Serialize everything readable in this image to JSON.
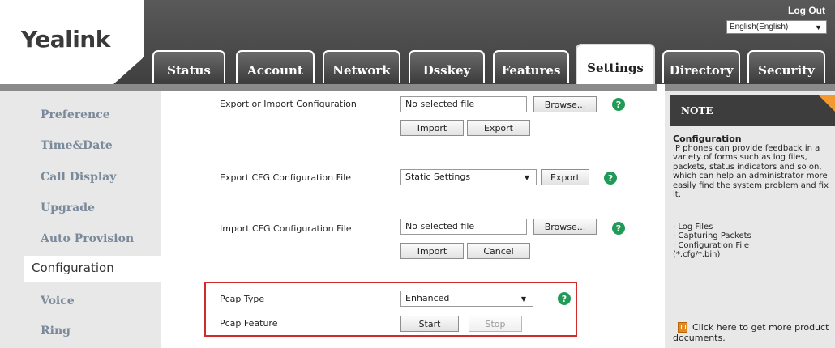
{
  "header": {
    "logo": "Yealink",
    "logout": "Log Out",
    "language": "English(English)"
  },
  "tabs": [
    {
      "label": "Status"
    },
    {
      "label": "Account"
    },
    {
      "label": "Network"
    },
    {
      "label": "Dsskey"
    },
    {
      "label": "Features"
    },
    {
      "label": "Settings",
      "active": true
    },
    {
      "label": "Directory"
    },
    {
      "label": "Security"
    }
  ],
  "sidebar": {
    "items": [
      {
        "label": "Preference"
      },
      {
        "label": "Time&Date"
      },
      {
        "label": "Call Display"
      },
      {
        "label": "Upgrade"
      },
      {
        "label": "Auto Provision"
      },
      {
        "label": "Configuration",
        "active": true
      },
      {
        "label": "Voice"
      },
      {
        "label": "Ring"
      }
    ]
  },
  "main": {
    "export_import": {
      "label": "Export or Import Configuration",
      "file_value": "No selected file",
      "browse": "Browse...",
      "import": "Import",
      "export": "Export"
    },
    "export_cfg": {
      "label": "Export CFG Configuration File",
      "select_value": "Static Settings",
      "export": "Export"
    },
    "import_cfg": {
      "label": "Import CFG Configuration File",
      "file_value": "No selected file",
      "browse": "Browse...",
      "import": "Import",
      "cancel": "Cancel"
    },
    "pcap": {
      "type_label": "Pcap Type",
      "type_value": "Enhanced",
      "feature_label": "Pcap Feature",
      "start": "Start",
      "stop": "Stop"
    },
    "help_glyph": "?"
  },
  "note": {
    "header": "NOTE",
    "title": "Configuration",
    "body": "IP phones can provide feedback in a variety of forms such as log files, packets, status indicators and so on, which can help an administrator more easily find the system problem and fix it.",
    "items": [
      "· Log Files",
      "· Capturing Packets",
      "· Configuration File",
      "(*.cfg/*.bin)"
    ],
    "link": "Click here to get more product documents."
  }
}
